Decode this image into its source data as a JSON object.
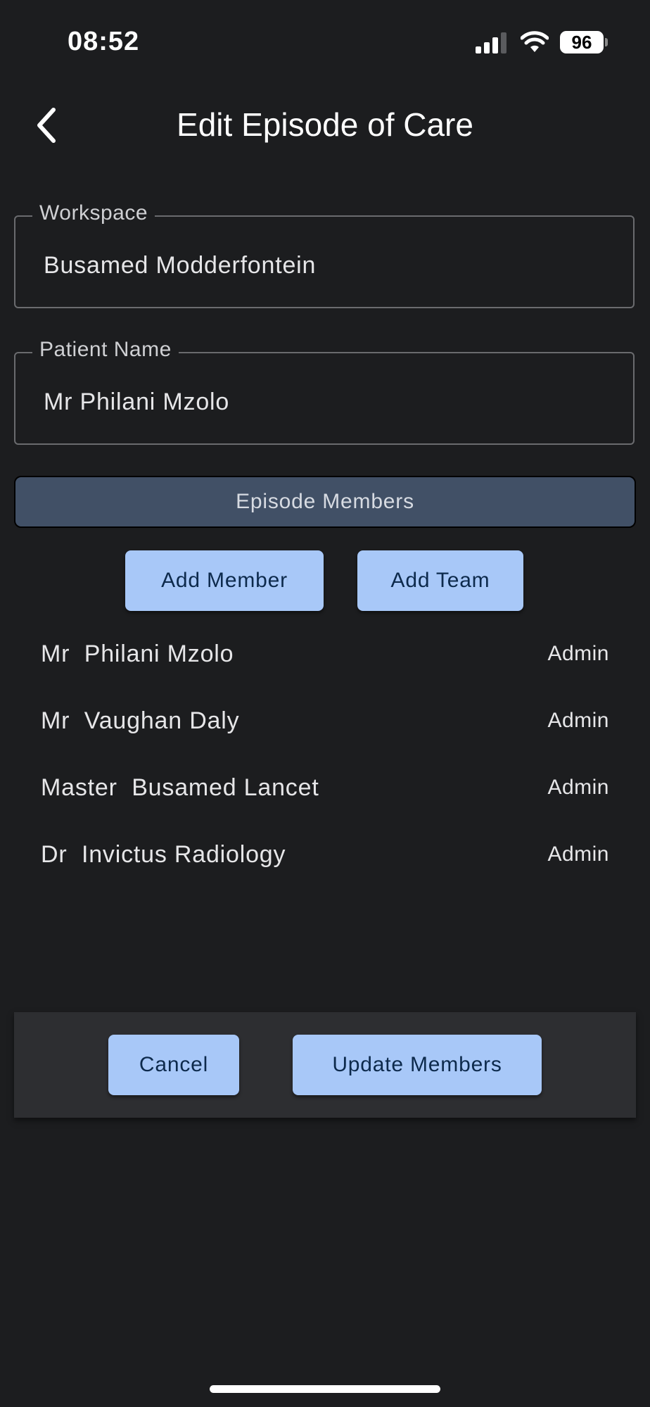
{
  "status_bar": {
    "time": "08:52",
    "battery": "96"
  },
  "header": {
    "title": "Edit Episode of Care",
    "back_icon": "chevron-left-icon"
  },
  "fields": {
    "workspace": {
      "label": "Workspace",
      "value": "Busamed Modderfontein"
    },
    "patient_name": {
      "label": "Patient Name",
      "value": "Mr Philani Mzolo"
    }
  },
  "section": {
    "title": "Episode Members"
  },
  "actions": {
    "add_member": "Add Member",
    "add_team": "Add Team",
    "cancel": "Cancel",
    "update_members": "Update Members"
  },
  "members": [
    {
      "name": "Mr  Philani Mzolo",
      "role": "Admin"
    },
    {
      "name": "Mr  Vaughan Daly",
      "role": "Admin"
    },
    {
      "name": "Master  Busamed Lancet",
      "role": "Admin"
    },
    {
      "name": "Dr  Invictus Radiology",
      "role": "Admin"
    }
  ],
  "colors": {
    "background": "#1c1d1f",
    "section_bar": "#415066",
    "button_bg": "#a8c8f8",
    "button_text": "#0d2a4c",
    "action_bar": "#2d2e31"
  }
}
